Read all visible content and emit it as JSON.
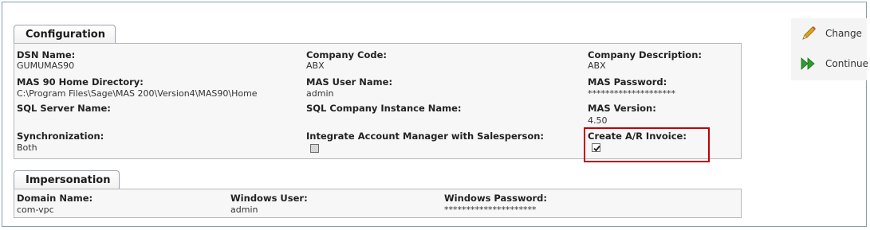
{
  "configuration": {
    "tab_label": "Configuration",
    "dsn_name": {
      "label": "DSN Name:",
      "value": "GUMUMAS90"
    },
    "company_code": {
      "label": "Company Code:",
      "value": "ABX"
    },
    "company_description": {
      "label": "Company Description:",
      "value": "ABX"
    },
    "home_directory": {
      "label": "MAS 90 Home Directory:",
      "value": "C:\\Program Files\\Sage\\MAS 200\\Version4\\MAS90\\Home"
    },
    "mas_user_name": {
      "label": "MAS User Name:",
      "value": "admin"
    },
    "mas_password": {
      "label": "MAS Password:",
      "value": "********************"
    },
    "sql_server_name": {
      "label": "SQL Server Name:",
      "value": ""
    },
    "sql_company_instance": {
      "label": "SQL Company Instance Name:",
      "value": ""
    },
    "mas_version": {
      "label": "MAS Version:",
      "value": "4.50"
    },
    "synchronization": {
      "label": "Synchronization:",
      "value": "Both"
    },
    "integrate_account_manager": {
      "label": "Integrate Account Manager with Salesperson:",
      "checked": false,
      "disabled": true
    },
    "create_ar_invoice": {
      "label": "Create A/R Invoice:",
      "checked": true
    }
  },
  "impersonation": {
    "tab_label": "Impersonation",
    "domain_name": {
      "label": "Domain Name:",
      "value": "com-vpc"
    },
    "windows_user": {
      "label": "Windows User:",
      "value": "admin"
    },
    "windows_password": {
      "label": "Windows Password:",
      "value": "*********************"
    }
  },
  "actions": {
    "change_label": "Change",
    "continue_label": "Continue"
  },
  "colors": {
    "highlight": "#c00000",
    "continue_icon": "#2e9b2e",
    "pencil": "#e0a020"
  }
}
